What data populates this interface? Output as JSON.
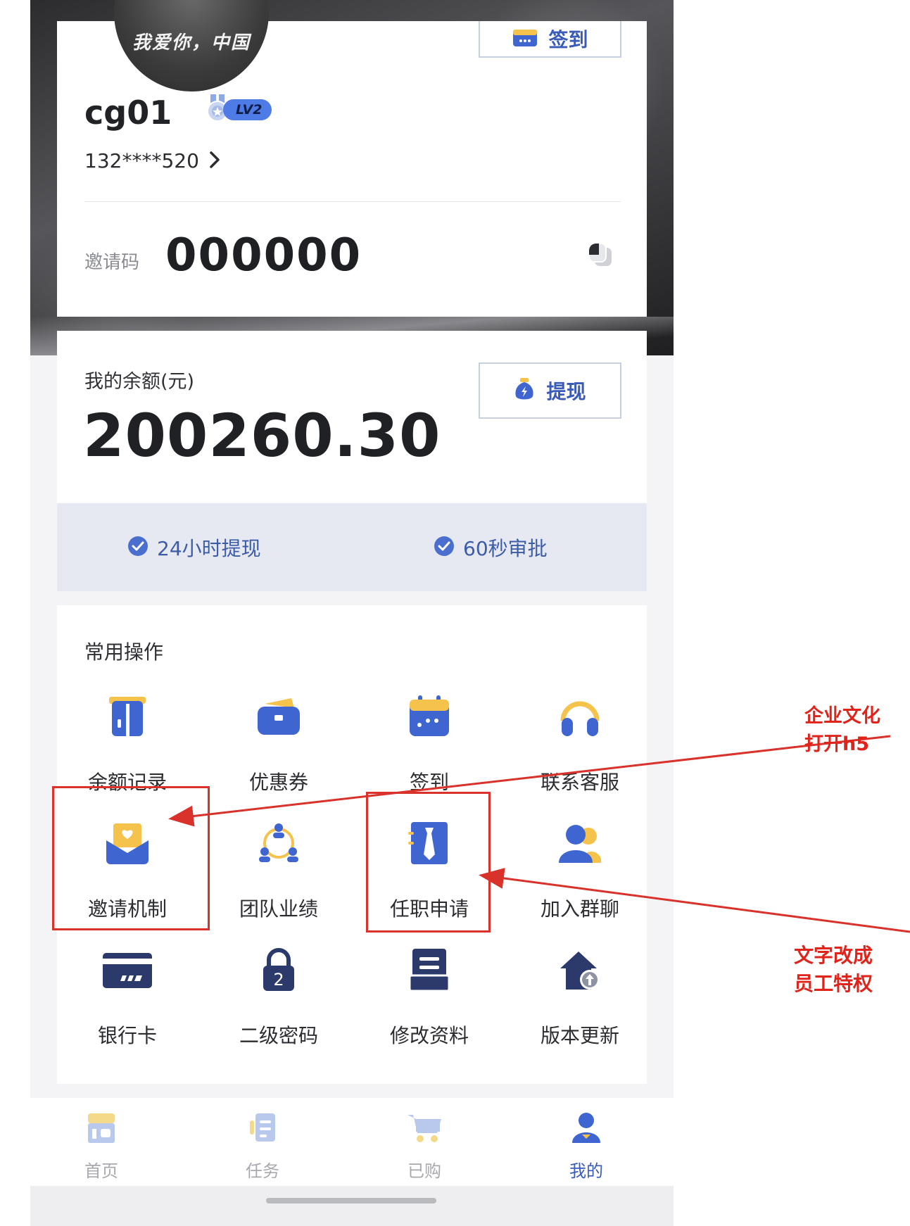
{
  "profile": {
    "avatar_caption": "我爱你，中国",
    "checkin_label": "签到",
    "username": "cg01",
    "level": "LV2",
    "phone": "132****520",
    "invite_label": "邀请码",
    "invite_code": "000000"
  },
  "balance": {
    "label": "我的余额(元)",
    "amount": "200260.30",
    "withdraw_label": "提现"
  },
  "features": [
    "24小时提现",
    "60秒审批"
  ],
  "common_ops": {
    "title": "常用操作",
    "items": [
      {
        "label": "余额记录",
        "icon": "balance-record-icon"
      },
      {
        "label": "优惠券",
        "icon": "coupon-icon"
      },
      {
        "label": "签到",
        "icon": "calendar-icon"
      },
      {
        "label": "联系客服",
        "icon": "headset-icon"
      },
      {
        "label": "邀请机制",
        "icon": "invite-envelope-icon"
      },
      {
        "label": "团队业绩",
        "icon": "team-icon"
      },
      {
        "label": "任职申请",
        "icon": "tie-icon"
      },
      {
        "label": "加入群聊",
        "icon": "group-chat-icon"
      },
      {
        "label": "银行卡",
        "icon": "bank-card-icon"
      },
      {
        "label": "二级密码",
        "icon": "padlock-icon"
      },
      {
        "label": "修改资料",
        "icon": "edit-profile-icon"
      },
      {
        "label": "版本更新",
        "icon": "update-icon"
      }
    ]
  },
  "bottom_nav": {
    "items": [
      {
        "label": "首页",
        "icon": "home-shop-icon"
      },
      {
        "label": "任务",
        "icon": "task-icon"
      },
      {
        "label": "已购",
        "icon": "cart-icon"
      },
      {
        "label": "我的",
        "icon": "user-icon",
        "active": true
      }
    ]
  },
  "annotations": {
    "note_1_line_1": "企业文化",
    "note_1_line_2": "打开h5",
    "note_2_line_1": "文字改成",
    "note_2_line_2": "员工特权"
  },
  "colors": {
    "accent": "#3a5bb7",
    "icon_blue": "#3f66d0",
    "icon_yellow": "#f5c24c",
    "annotation_red": "#d9322b"
  }
}
